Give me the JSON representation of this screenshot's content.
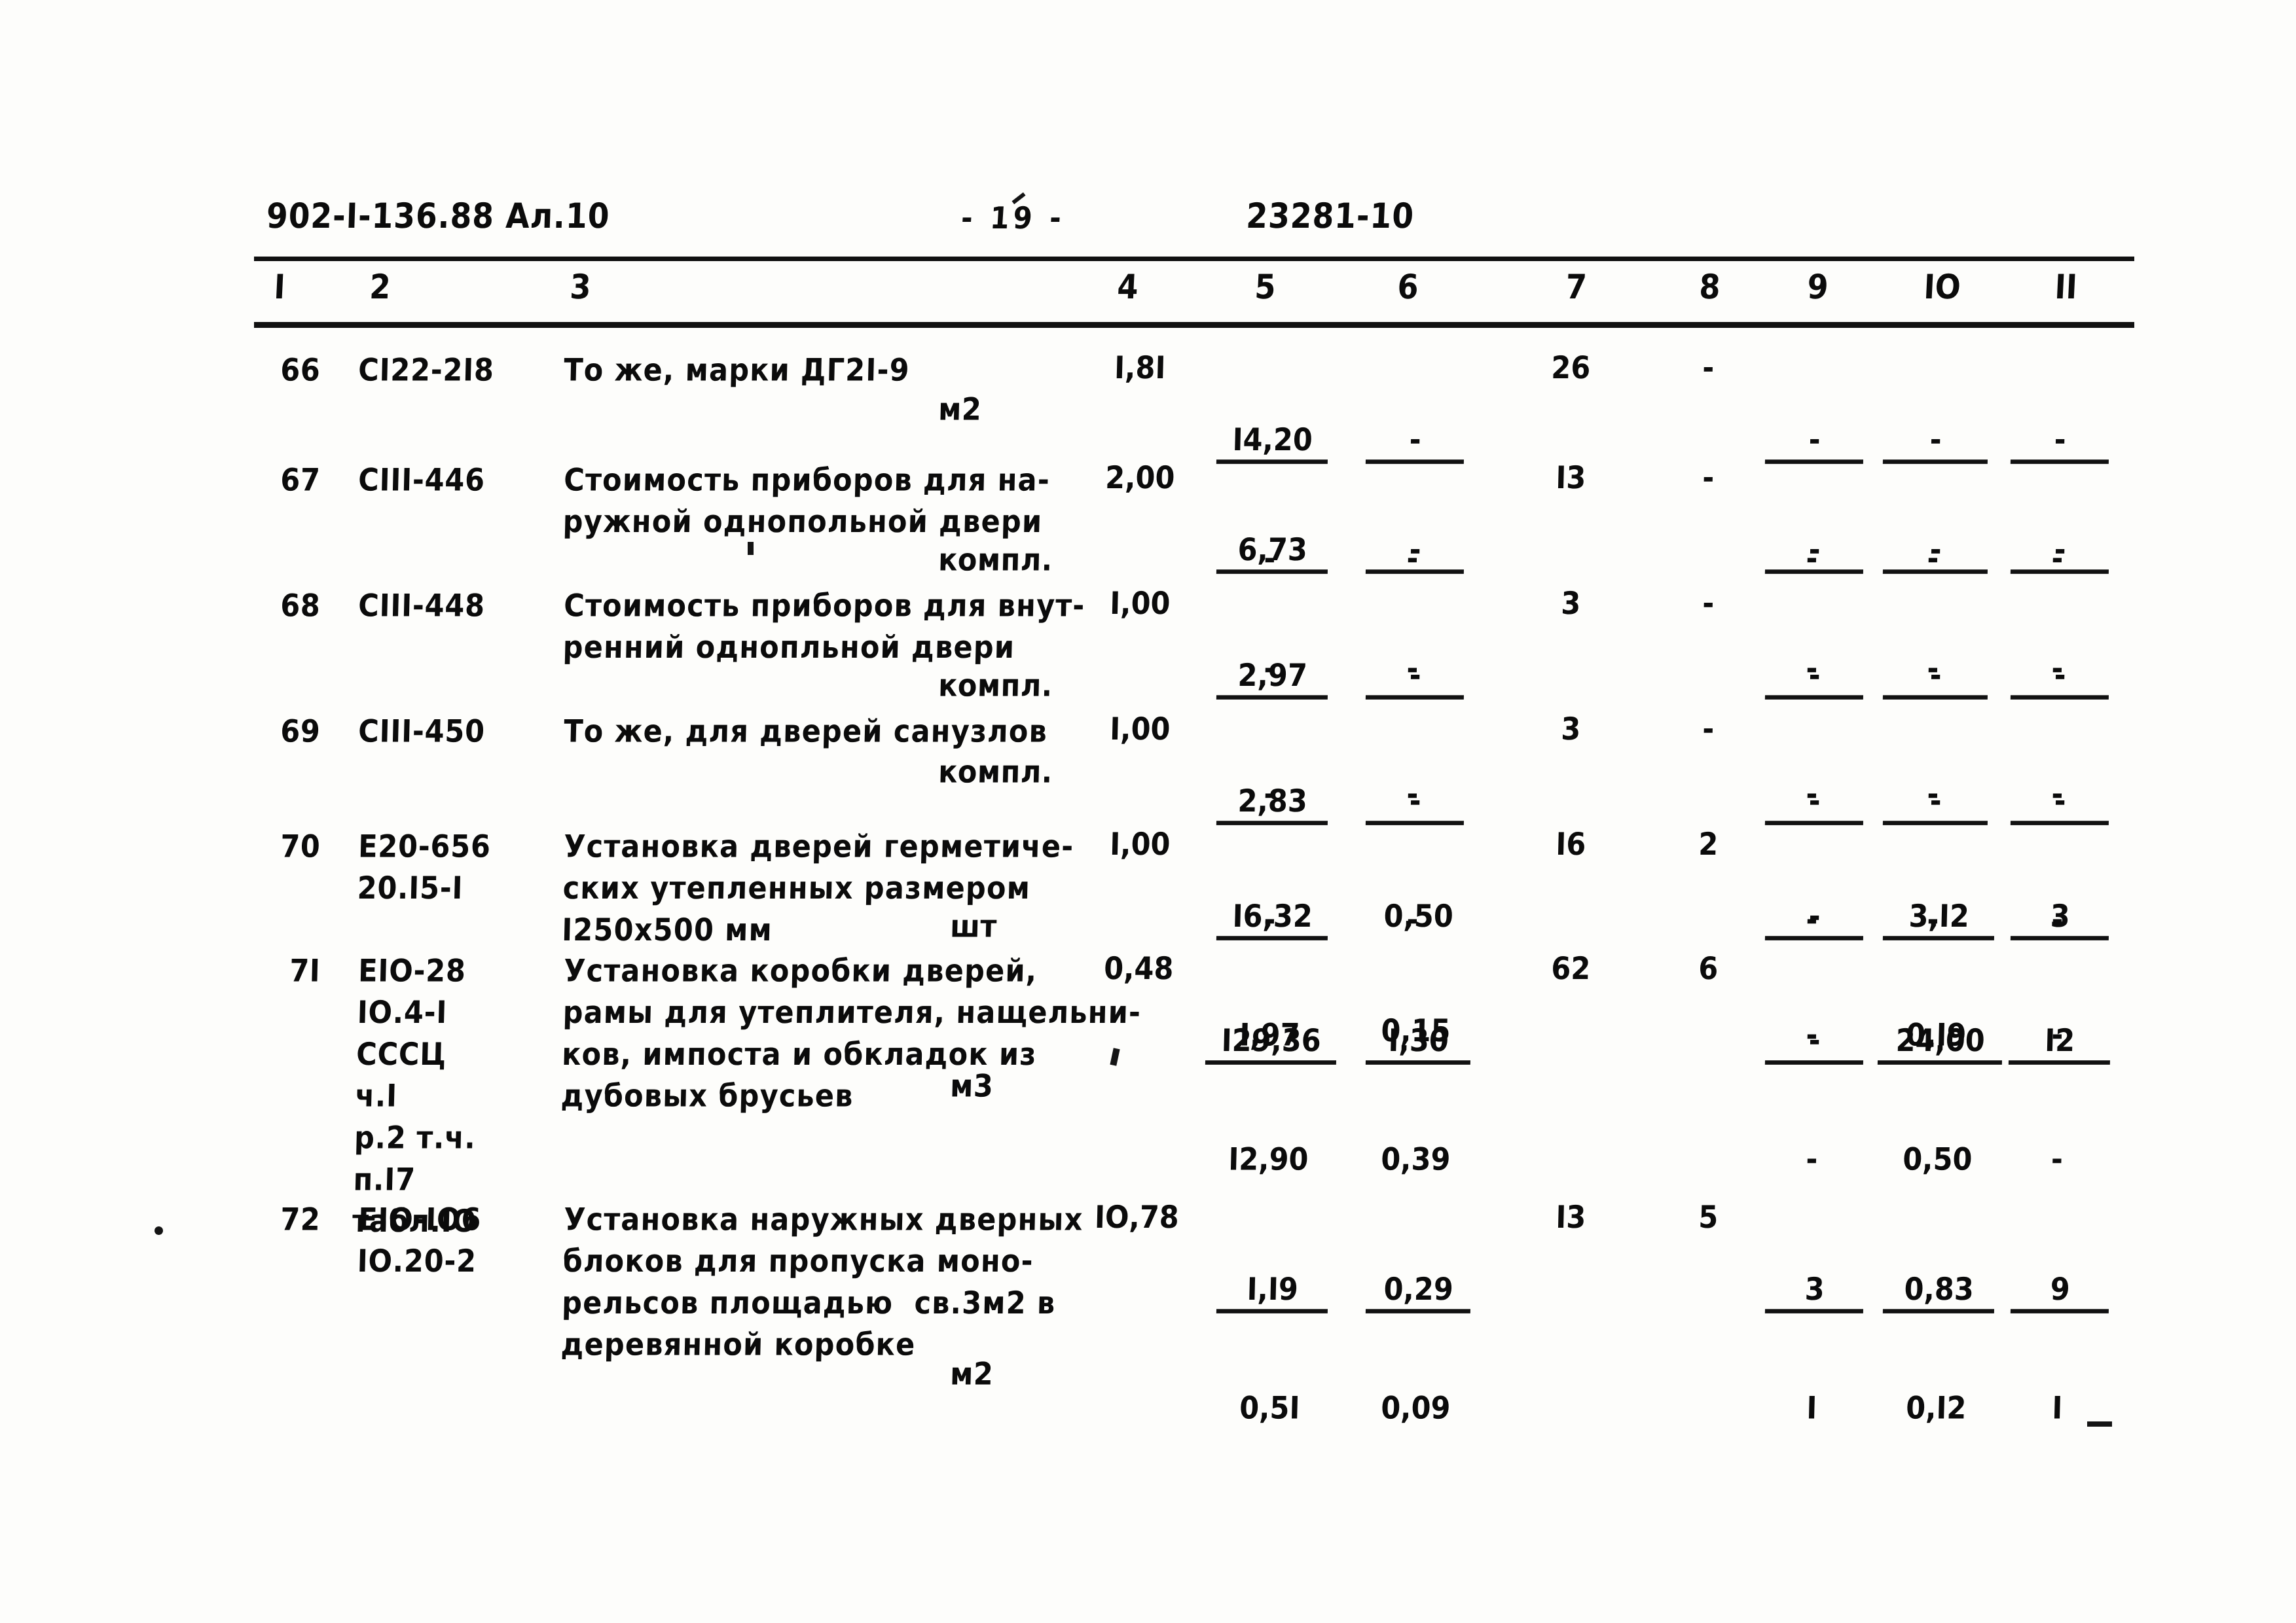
{
  "header": {
    "doc_code": "902-I-136.88 Ал.10",
    "page_number": "- 19 -",
    "doc_id": "23281-10"
  },
  "table": {
    "column_headers": [
      "I",
      "2",
      "3",
      "4",
      "5",
      "6",
      "7",
      "8",
      "9",
      "IO",
      "II"
    ],
    "rows": [
      {
        "idx": "66",
        "code": "CI22-2I8",
        "desc": "То же, марки ДГ2I-9",
        "unit": "м2",
        "c4": "I,8I",
        "c5_top": "I4,20",
        "c5_bot": "-",
        "c6_top": "-",
        "c6_bot": "-",
        "c7": "26",
        "c8": "-",
        "c9_top": "-",
        "c9_bot": "-",
        "c10_top": "-",
        "c10_bot": "-",
        "c11_top": "-",
        "c11_bot": "-"
      },
      {
        "idx": "67",
        "code": "CIII-446",
        "desc": "Стоимость приборов для на-\nружной однопольной двери",
        "unit": "компл.",
        "c4": "2,00",
        "c5_top": "6,73",
        "c5_bot": "-",
        "c6_top": "-",
        "c6_bot": "-",
        "c7": "I3",
        "c8": "-",
        "c9_top": "-",
        "c9_bot": "-",
        "c10_top": "-",
        "c10_bot": "-",
        "c11_top": "-",
        "c11_bot": "-"
      },
      {
        "idx": "68",
        "code": "CIII-448",
        "desc": "Стоимость приборов для внут-\nренний однопльной двери",
        "unit": "компл.",
        "c4": "I,00",
        "c5_top": "2,97",
        "c5_bot": "-",
        "c6_top": "-",
        "c6_bot": "-",
        "c7": "3",
        "c8": "-",
        "c9_top": "-",
        "c9_bot": "-",
        "c10_top": "-",
        "c10_bot": "-",
        "c11_top": "-",
        "c11_bot": "-"
      },
      {
        "idx": "69",
        "code": "CIII-450",
        "desc": "То же, для дверей санузлов",
        "unit": "компл.",
        "c4": "I,00",
        "c5_top": "2,83",
        "c5_bot": "-",
        "c6_top": "-",
        "c6_bot": "-",
        "c7": "3",
        "c8": "-",
        "c9_top": "-",
        "c9_bot": "-",
        "c10_top": "-",
        "c10_bot": "-",
        "c11_top": "-",
        "c11_bot": "-"
      },
      {
        "idx": "70",
        "code": "Е20-656\n20.I5-I",
        "desc": "Установка дверей герметиче-\nских утепленных размером\nI250х500 мм",
        "unit": "шт",
        "c4": "I,00",
        "c5_top": "I6,32",
        "c5_bot": "I,97",
        "c6_top": "0,50",
        "c6_bot": "0,15",
        "c7": "I6",
        "c8": "2",
        "c9_top": "-",
        "c9_bot": "-",
        "c10_top": "3,I2",
        "c10_bot": "0,I9",
        "c11_top": "3",
        "c11_bot": "-"
      },
      {
        "idx": "7I",
        "code": "ЕIО-28\nIО.4-I\nСССЦ\nч.I\nр.2 т.ч.\nп.I7\nтабл.IО",
        "desc": "Установка коробки дверей,\nрамы для утеплителя, нащельни-\nков, импоста и обкладок из\nдубовых брусьев",
        "unit": "м3",
        "c4": "0,48",
        "c5_top": "I29,36",
        "c5_bot": "I2,90",
        "c6_top": "I,30",
        "c6_bot": "0,39",
        "c7": "62",
        "c8": "6",
        "c9_top": "-",
        "c9_bot": "-",
        "c10_top": "24,00",
        "c10_bot": "0,50",
        "c11_top": "I2",
        "c11_bot": "-"
      },
      {
        "idx": "72",
        "code": "ЕIО-IО6\nIО.20-2",
        "desc": "Установка наружных дверных\nблоков для пропуска моно-\nрельсов площадью  св.3м2 в\nдеревянной коробке",
        "unit": "м2",
        "c4": "IО,78",
        "c5_top": "I,I9",
        "c5_bot": "0,5I",
        "c6_top": "0,29",
        "c6_bot": "0,09",
        "c7": "I3",
        "c8": "5",
        "c9_top": "3",
        "c9_bot": "I",
        "c10_top": "0,83",
        "c10_bot": "0,I2",
        "c11_top": "9",
        "c11_bot": "I"
      }
    ]
  }
}
